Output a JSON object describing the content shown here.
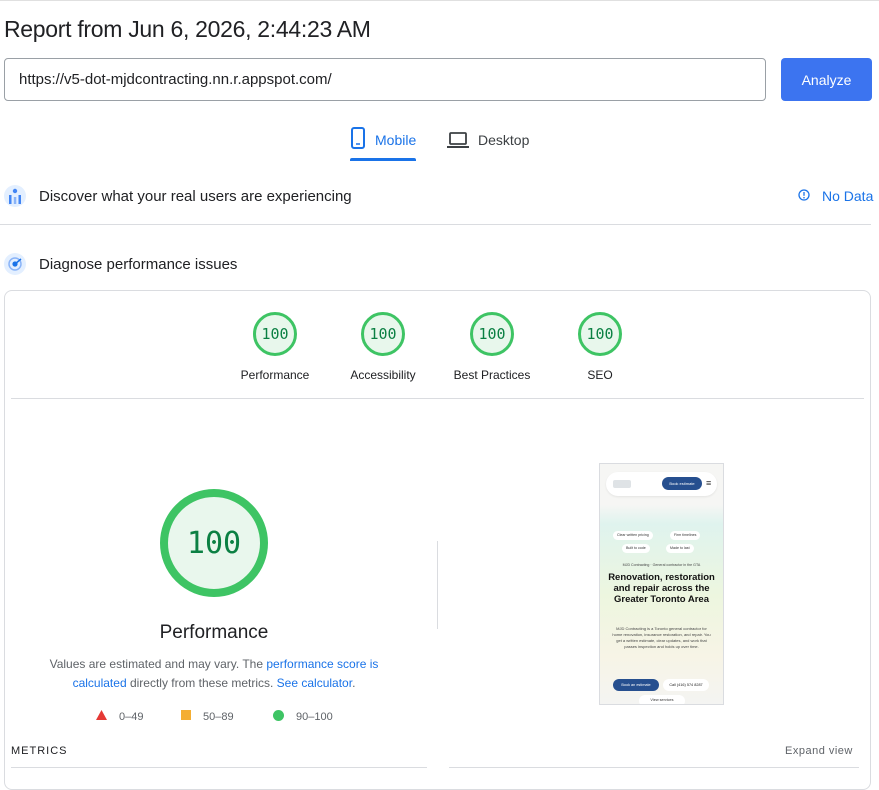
{
  "report": {
    "title": "Report from Jun 6, 2026, 2:44:23 AM"
  },
  "url_bar": {
    "value": "https://v5-dot-mjdcontracting.nn.r.appspot.com/",
    "analyze_label": "Analyze"
  },
  "tabs": [
    {
      "label": "Mobile",
      "icon": "smartphone-icon",
      "selected": true
    },
    {
      "label": "Desktop",
      "icon": "laptop-icon",
      "selected": false
    }
  ],
  "field_data": {
    "title": "Discover what your real users are experiencing",
    "status": "No Data"
  },
  "lab_data": {
    "title": "Diagnose performance issues"
  },
  "categories": [
    {
      "label": "Performance",
      "score": "100"
    },
    {
      "label": "Accessibility",
      "score": "100"
    },
    {
      "label": "Best Practices",
      "score": "100"
    },
    {
      "label": "SEO",
      "score": "100"
    }
  ],
  "main_gauge": {
    "score": "100",
    "label": "Performance",
    "desc_prefix": "Values are estimated and may vary. The ",
    "desc_link": "performance score is calculated",
    "desc_middle": " directly from these metrics. ",
    "desc_link2": "See calculator",
    "desc_suffix": "."
  },
  "legend": [
    {
      "range": "0–49",
      "color": "#e53935"
    },
    {
      "range": "50–89",
      "color": "#f4ae33"
    },
    {
      "range": "90–100",
      "color": "#3ec464"
    }
  ],
  "metrics": {
    "header": "METRICS",
    "expand": "Expand view"
  },
  "preview": {
    "book_label": "Book estimate",
    "chips": [
      "Clear written pricing",
      "Firm timelines",
      "Built to code",
      "Made to last"
    ],
    "eyebrow": "MJD Contracting · General contractor in the GTA",
    "headline": "Renovation, restoration and repair across the Greater Toronto Area",
    "body": "MJD Contracting is a Toronto general contractor for home renovation, insurance restoration, and repair. You get a written estimate, clear updates, and work that passes inspection and holds up over time.",
    "cta_primary": "Book an estimate",
    "cta_phone": "Call (416) 574 8287",
    "cta_services": "View services"
  },
  "colors": {
    "accent": "#1a73e8",
    "button": "#3c74f0",
    "pass": "#3ec464",
    "pass_text": "#0b8043"
  }
}
